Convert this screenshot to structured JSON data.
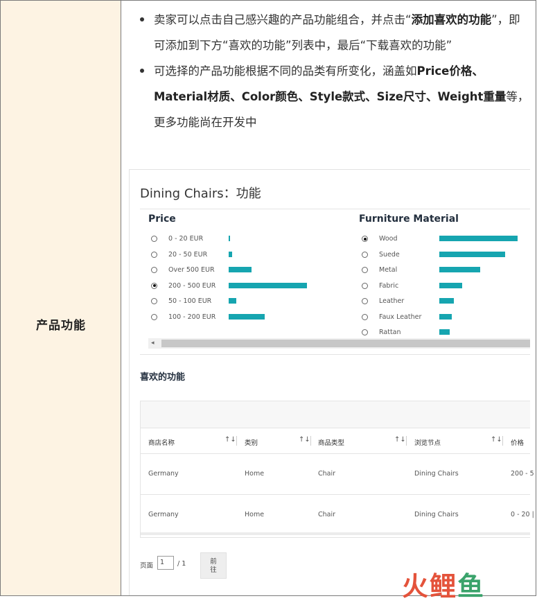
{
  "left_label": "产品功能",
  "bullets": {
    "b1_part1": "卖家可以点击自己感兴趣的产品功能组合，并点击“",
    "b1_bold": "添加喜欢的功能",
    "b1_part2": "”，即可添加到下方“喜欢的功能”列表中，最后“下载喜欢的功能”",
    "b2_part1": "可选择的产品功能根据不同的品类有所变化，涵盖如",
    "b2_bold": "Price价格、Material材质、Color颜色、Style款式、Size尺寸、Weight重量",
    "b2_part2": "等，更多功能尚在开发中"
  },
  "screenshot": {
    "title": "Dining Chairs：功能",
    "price_facet": {
      "title": "Price",
      "options": [
        {
          "label": "0 - 20 EUR",
          "checked": false,
          "share": 0.02
        },
        {
          "label": "20 - 50 EUR",
          "checked": false,
          "share": 0.04
        },
        {
          "label": "Over 500 EUR",
          "checked": false,
          "share": 0.29
        },
        {
          "label": "200 - 500 EUR",
          "checked": true,
          "share": 1.0
        },
        {
          "label": "50 - 100 EUR",
          "checked": false,
          "share": 0.1
        },
        {
          "label": "100 - 200 EUR",
          "checked": false,
          "share": 0.46
        }
      ]
    },
    "material_facet": {
      "title": "Furniture Material",
      "options": [
        {
          "label": "Wood",
          "checked": true,
          "share": 1.0
        },
        {
          "label": "Suede",
          "checked": false,
          "share": 0.84
        },
        {
          "label": "Metal",
          "checked": false,
          "share": 0.52
        },
        {
          "label": "Fabric",
          "checked": false,
          "share": 0.29
        },
        {
          "label": "Leather",
          "checked": false,
          "share": 0.19
        },
        {
          "label": "Faux Leather",
          "checked": false,
          "share": 0.16
        },
        {
          "label": "Rattan",
          "checked": false,
          "share": 0.13
        }
      ]
    },
    "scroll_arrow": "◂",
    "favorites_title": "喜欢的功能",
    "table": {
      "headers": [
        "商店名称",
        "类别",
        "商品类型",
        "浏览节点",
        "价格"
      ],
      "sort_icon": "↑↓",
      "rows": [
        [
          "Germany",
          "Home",
          "Chair",
          "Dining Chairs",
          "200 - 5"
        ],
        [
          "Germany",
          "Home",
          "Chair",
          "Dining Chairs",
          "0 - 20 |"
        ]
      ]
    },
    "pager": {
      "label": "页面",
      "value": "1",
      "of": "/ 1",
      "go_line1": "前",
      "go_line2": "往"
    }
  },
  "watermark": {
    "c1": "火",
    "c2": "鲤",
    "c3": "鱼"
  }
}
